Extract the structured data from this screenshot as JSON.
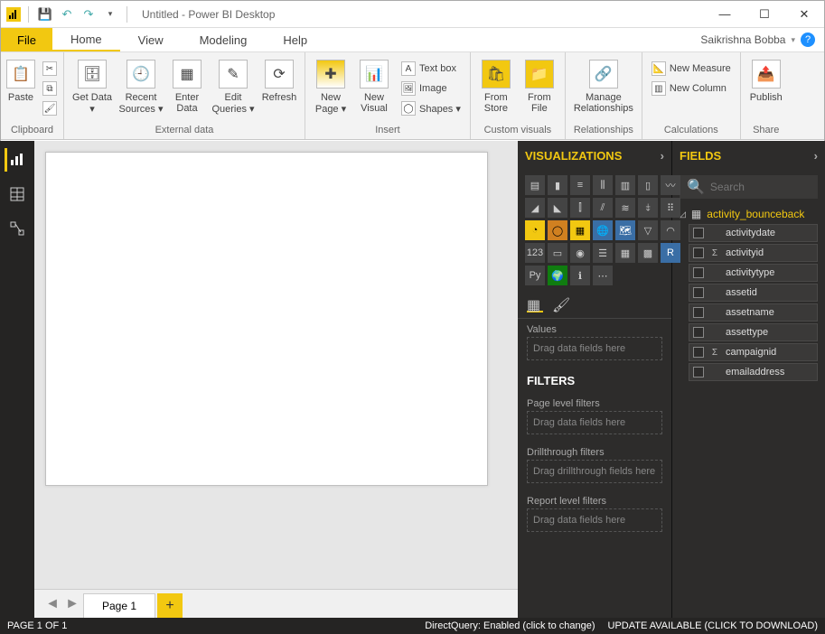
{
  "title": "Untitled - Power BI Desktop",
  "user": "Saikrishna Bobba",
  "menus": {
    "file": "File",
    "home": "Home",
    "view": "View",
    "modeling": "Modeling",
    "help": "Help"
  },
  "ribbon": {
    "clipboard": {
      "paste": "Paste",
      "label": "Clipboard"
    },
    "external": {
      "getdata": "Get Data ▾",
      "recent": "Recent Sources ▾",
      "enter": "Enter Data",
      "edit": "Edit Queries ▾",
      "refresh": "Refresh",
      "label": "External data"
    },
    "insert": {
      "newpage": "New Page ▾",
      "newvisual": "New Visual",
      "textbox": "Text box",
      "image": "Image",
      "shapes": "Shapes ▾",
      "label": "Insert"
    },
    "custom": {
      "store": "From Store",
      "file": "From File",
      "label": "Custom visuals"
    },
    "rel": {
      "manage": "Manage Relationships",
      "label": "Relationships"
    },
    "calc": {
      "measure": "New Measure",
      "column": "New Column",
      "label": "Calculations"
    },
    "share": {
      "publish": "Publish",
      "label": "Share"
    }
  },
  "viz": {
    "title": "VISUALIZATIONS",
    "values_label": "Values",
    "drop_values": "Drag data fields here",
    "filters_title": "FILTERS",
    "page_filters": "Page level filters",
    "drop_page": "Drag data fields here",
    "drill_filters": "Drillthrough filters",
    "drop_drill": "Drag drillthrough fields here",
    "report_filters": "Report level filters",
    "drop_report": "Drag data fields here",
    "types": [
      "stacked-bar",
      "stacked-column",
      "clustered-bar",
      "clustered-column",
      "100-bar",
      "100-column",
      "line",
      "area",
      "stacked-area",
      "line-stacked-col",
      "line-clustered-col",
      "ribbon",
      "waterfall",
      "scatter",
      "pie",
      "donut",
      "treemap",
      "map",
      "filled-map",
      "funnel",
      "gauge",
      "card",
      "multi-card",
      "kpi",
      "slicer",
      "table",
      "matrix",
      "r-visual",
      "python",
      "arcgis",
      "keyinf",
      "more"
    ]
  },
  "fields": {
    "title": "FIELDS",
    "search_ph": "Search",
    "table": "activity_bounceback",
    "cols": [
      {
        "n": "activitydate",
        "sigma": false
      },
      {
        "n": "activityid",
        "sigma": true
      },
      {
        "n": "activitytype",
        "sigma": false
      },
      {
        "n": "assetid",
        "sigma": false
      },
      {
        "n": "assetname",
        "sigma": false
      },
      {
        "n": "assettype",
        "sigma": false
      },
      {
        "n": "campaignid",
        "sigma": true
      },
      {
        "n": "emailaddress",
        "sigma": false
      }
    ]
  },
  "page_tab": "Page 1",
  "status": {
    "left": "PAGE 1 OF 1",
    "mid": "DirectQuery: Enabled (click to change)",
    "right": "UPDATE AVAILABLE (CLICK TO DOWNLOAD)"
  }
}
